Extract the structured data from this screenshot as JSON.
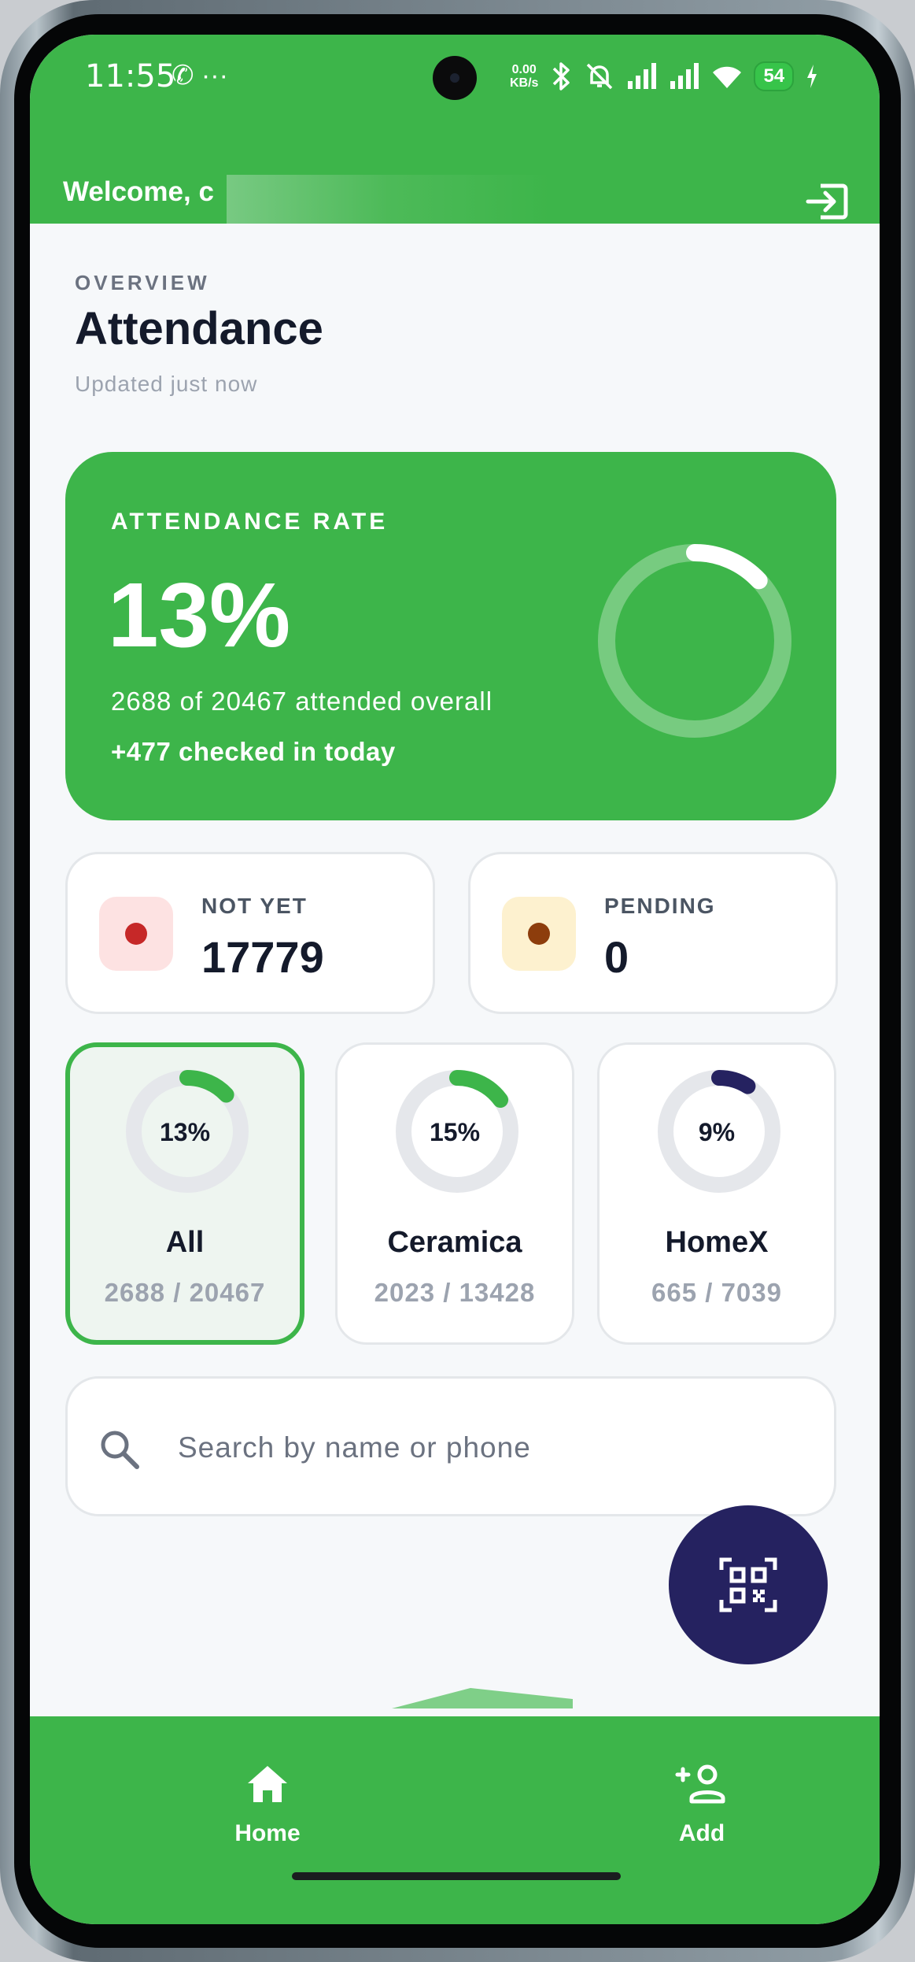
{
  "status_bar": {
    "time": "11:55",
    "left_icons": "✆ ···",
    "net_speed_value": "0.00",
    "net_speed_unit": "KB/s",
    "battery": "54"
  },
  "header": {
    "welcome": "Welcome, c",
    "logout_icon": "logout-icon"
  },
  "overview": {
    "eyebrow": "OVERVIEW",
    "title": "Attendance",
    "updated": "Updated just now"
  },
  "rate_card": {
    "label": "ATTENDANCE RATE",
    "value": "13%",
    "rate_fraction": 0.13,
    "overall": "2688 of 20467 attended overall",
    "today": "+477 checked in today"
  },
  "stats": [
    {
      "label": "NOT YET",
      "value": "17779",
      "badge_color": "#fde2e2",
      "dot_color": "#c62828"
    },
    {
      "label": "PENDING",
      "value": "0",
      "badge_color": "#fdf1cf",
      "dot_color": "#8d3d0c"
    }
  ],
  "segments": [
    {
      "name": "All",
      "pct": "13%",
      "fraction": 0.13,
      "count": "2688 / 20467",
      "color": "#3db54a",
      "selected": true
    },
    {
      "name": "Ceramica",
      "pct": "15%",
      "fraction": 0.15,
      "count": "2023 / 13428",
      "color": "#3db54a",
      "selected": false
    },
    {
      "name": "HomeX",
      "pct": "9%",
      "fraction": 0.09,
      "count": "665 / 7039",
      "color": "#252260",
      "selected": false
    }
  ],
  "search": {
    "placeholder": "Search by name or phone",
    "value": ""
  },
  "fab": {
    "icon": "qr-code-scanner-icon"
  },
  "nav": [
    {
      "label": "Home",
      "icon": "home-icon"
    },
    {
      "label": "Add",
      "icon": "add-person-icon"
    }
  ],
  "colors": {
    "primary": "#3db54a",
    "dark_accent": "#252260",
    "background": "#f6f8fa"
  }
}
